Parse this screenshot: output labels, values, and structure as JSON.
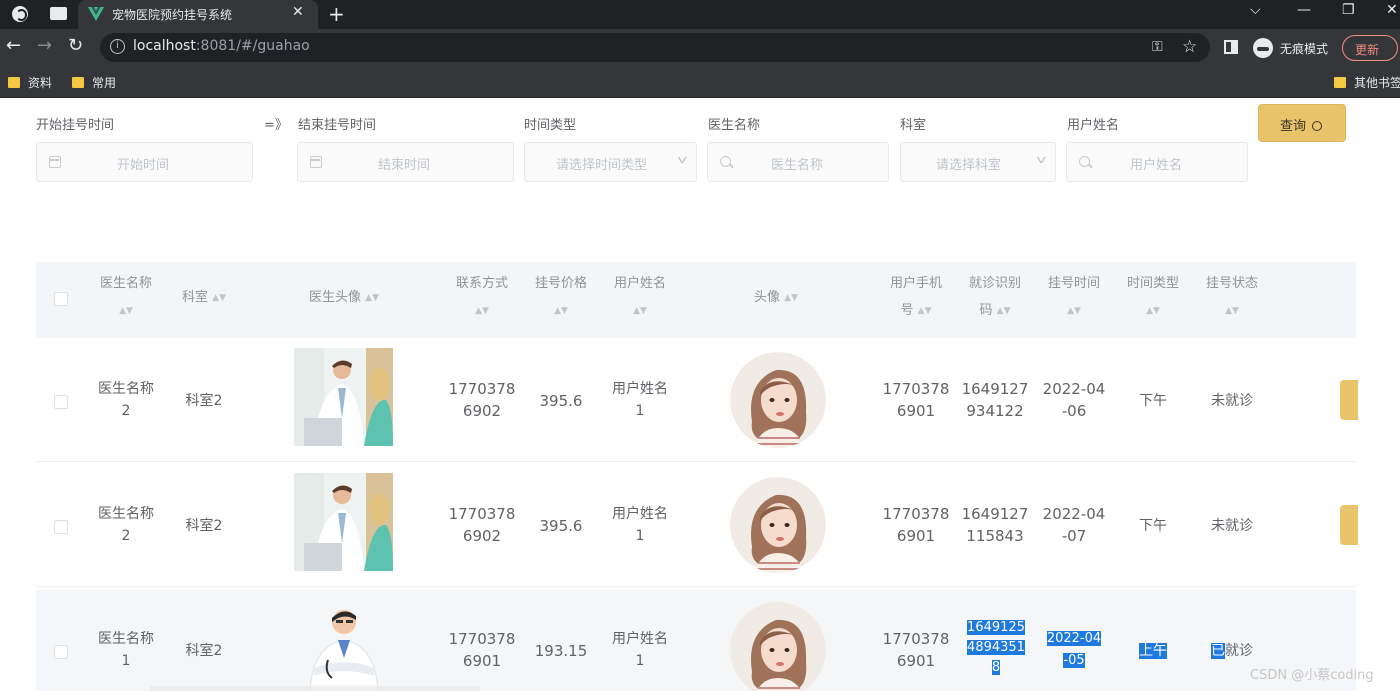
{
  "browser": {
    "tab_title": "宠物医院预约挂号系统",
    "url_host": "localhost",
    "url_port": ":8081",
    "url_path": "/#/guahao",
    "incognito_label": "无痕模式",
    "update_label": "更新",
    "bookmarks": [
      "资料",
      "常用"
    ],
    "other_bookmarks": "其他书签"
  },
  "filters": {
    "start_label": "开始挂号时间",
    "range_sep": "=》",
    "end_label": "结束挂号时间",
    "timetype_label": "时间类型",
    "doctor_label": "医生名称",
    "dept_label": "科室",
    "user_label": "用户姓名",
    "start_placeholder": "开始时间",
    "end_placeholder": "结束时间",
    "timetype_placeholder": "请选择时间类型",
    "doctor_placeholder": "医生名称",
    "dept_placeholder": "请选择科室",
    "user_placeholder": "用户姓名",
    "query_label": "查询"
  },
  "table": {
    "headers": {
      "doctor": "医生名称",
      "dept": "科室",
      "doctor_photo": "医生头像",
      "contact": "联系方式",
      "price": "挂号价格",
      "user_name": "用户姓名",
      "avatar": "头像",
      "user_phone_1": "用户手机",
      "user_phone_2": "号",
      "visit_code_1": "就诊识别",
      "visit_code_2": "码",
      "reg_time": "挂号时间",
      "time_type": "时间类型",
      "status": "挂号状态"
    },
    "rows": [
      {
        "doctor": [
          "医生名称",
          "2"
        ],
        "dept": "科室2",
        "contact": [
          "1770378",
          "6902"
        ],
        "price": "395.6",
        "user_name": [
          "用户姓名",
          "1"
        ],
        "user_phone": [
          "1770378",
          "6901"
        ],
        "visit_code": [
          "1649127",
          "934122"
        ],
        "reg_time": [
          "2022-04",
          "-06"
        ],
        "time_type": "下午",
        "status": "未就诊"
      },
      {
        "doctor": [
          "医生名称",
          "2"
        ],
        "dept": "科室2",
        "contact": [
          "1770378",
          "6902"
        ],
        "price": "395.6",
        "user_name": [
          "用户姓名",
          "1"
        ],
        "user_phone": [
          "1770378",
          "6901"
        ],
        "visit_code": [
          "1649127",
          "115843"
        ],
        "reg_time": [
          "2022-04",
          "-07"
        ],
        "time_type": "下午",
        "status": "未就诊"
      },
      {
        "doctor": [
          "医生名称",
          "1"
        ],
        "dept": "科室2",
        "contact": [
          "1770378",
          "6901"
        ],
        "price": "193.15",
        "user_name": [
          "用户姓名",
          "1"
        ],
        "user_phone": [
          "1770378",
          "6901"
        ],
        "visit_code": [
          "1649125",
          "4894351",
          "8"
        ],
        "reg_time": [
          "2022-04",
          "-05"
        ],
        "time_type": "上午",
        "status_hl": "已",
        "status_rest": "就诊"
      }
    ]
  },
  "watermark": "CSDN @小蔡coding",
  "colors": {
    "accent": "#e9c46a",
    "selection": "#1f7ae0",
    "header_bg": "#f3f5f7"
  }
}
